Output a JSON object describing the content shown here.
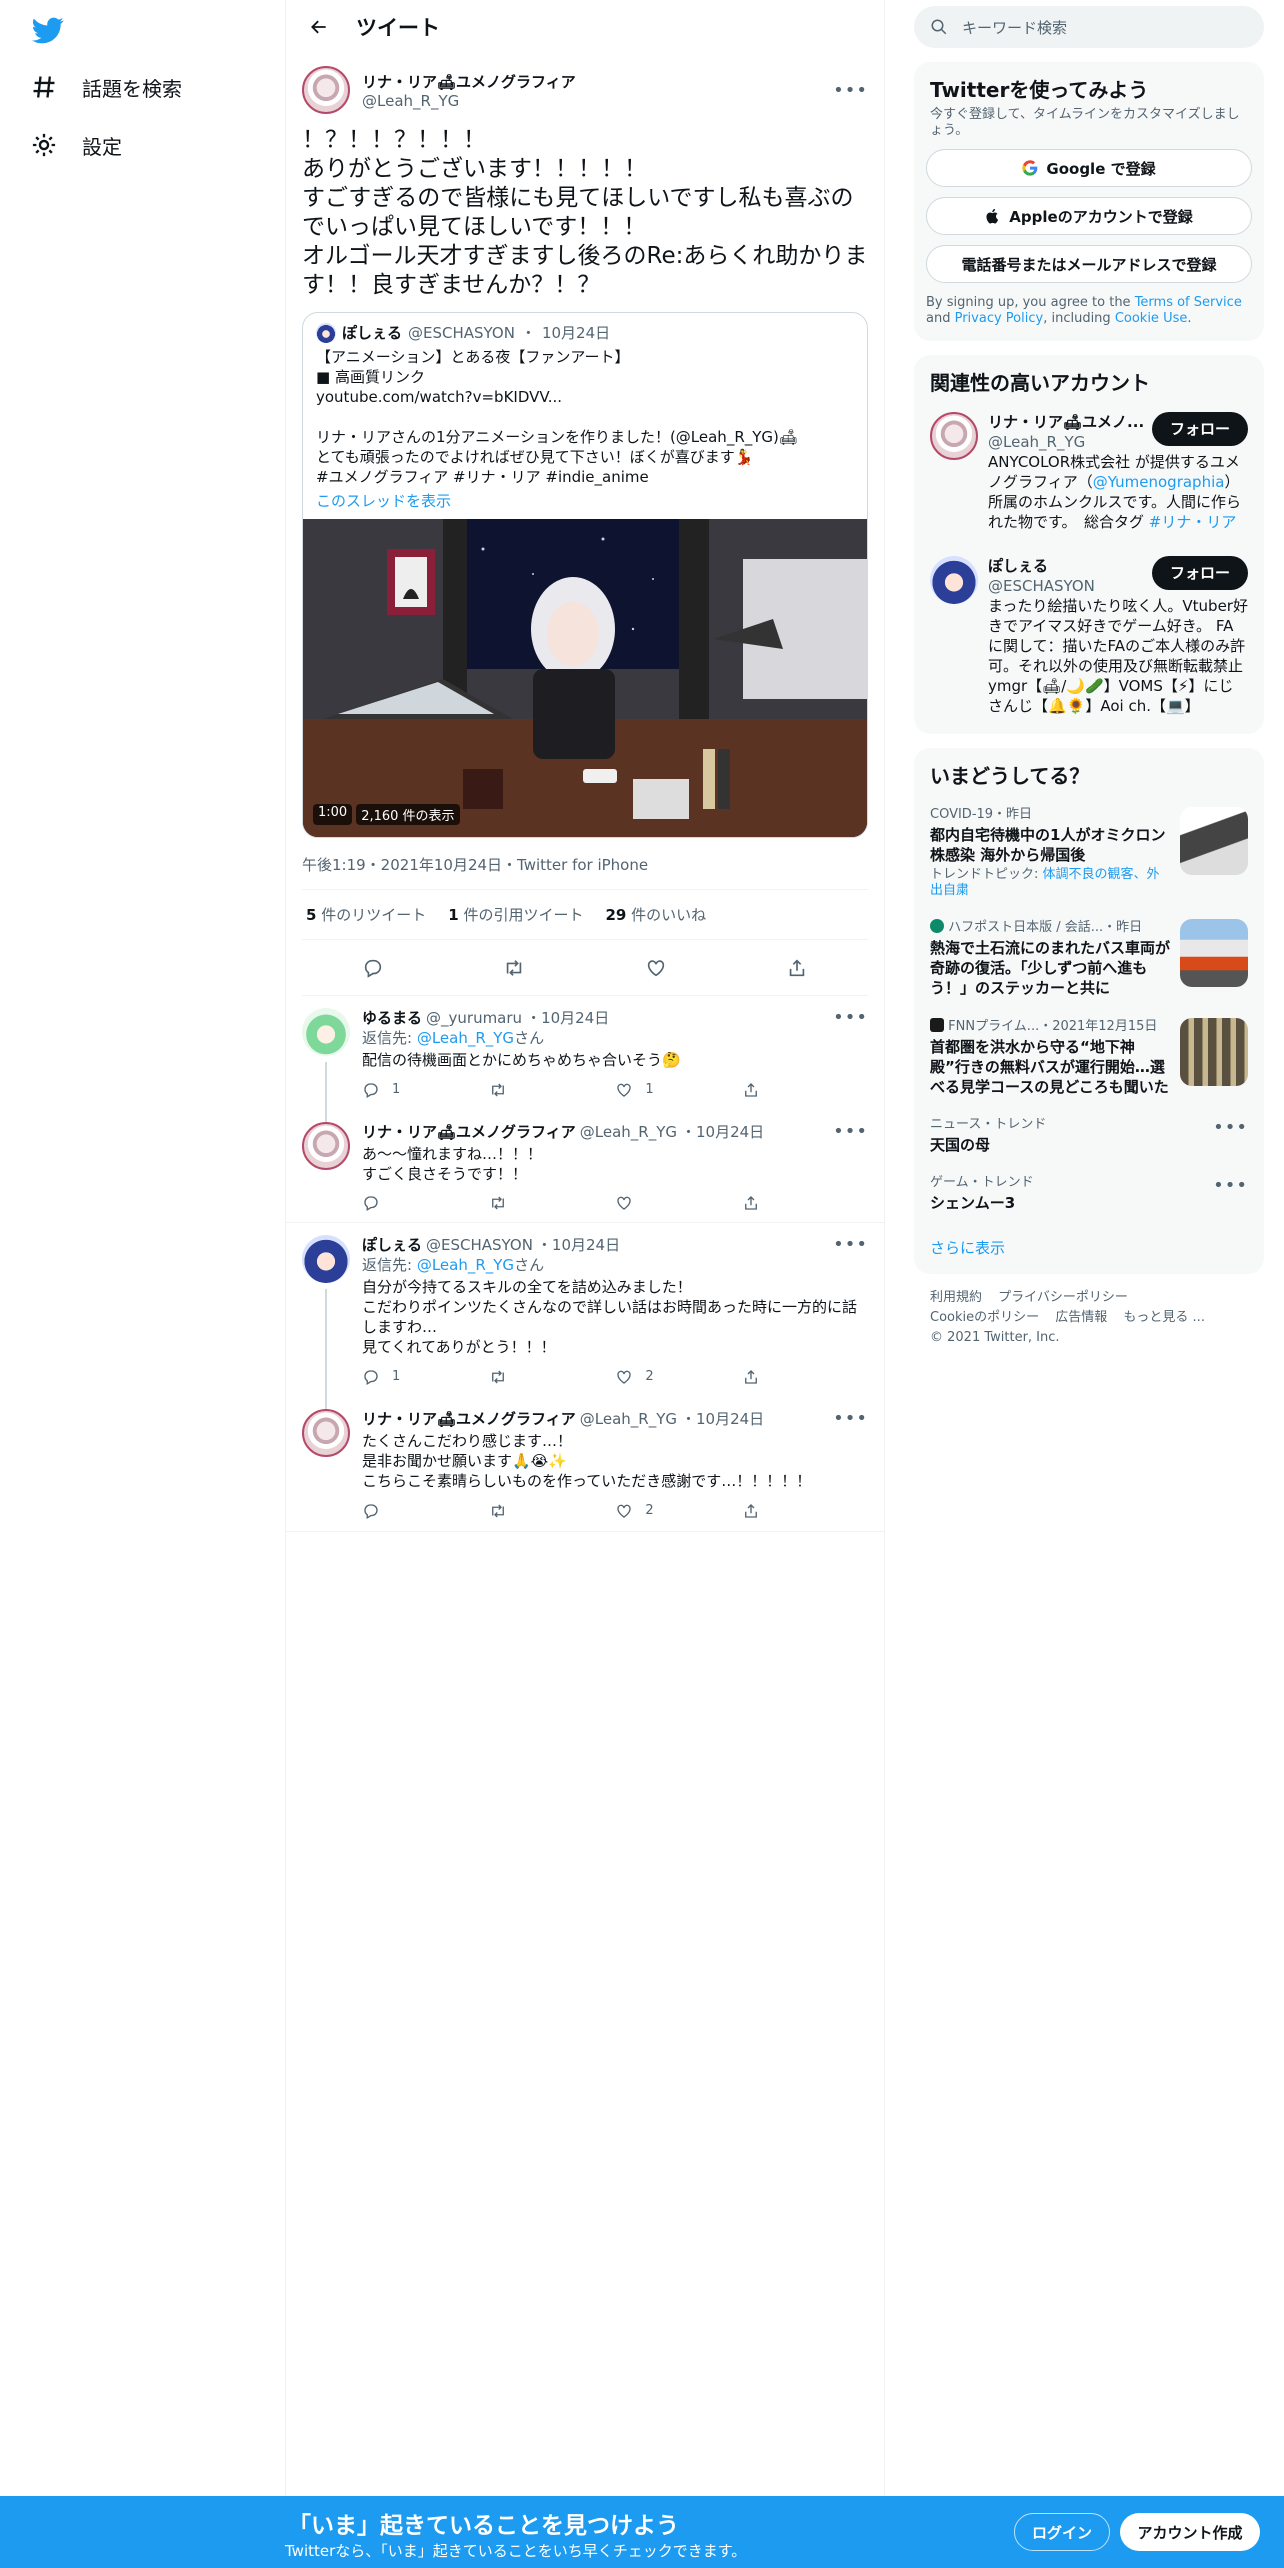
{
  "nav": {
    "items": [
      {
        "label": "話題を検索",
        "icon": "hashtag-icon"
      },
      {
        "label": "設定",
        "icon": "gear-icon"
      }
    ]
  },
  "header": {
    "title": "ツイート"
  },
  "main_tweet": {
    "name": "リナ・リア🛋ユメノグラフィア",
    "handle": "@Leah_R_YG",
    "text": "！？！！？！！！\nありがとうございます！！！！！\nすごすぎるので皆様にも見てほしいですし私も喜ぶのでいっぱい見てほしいです！！！\nオルゴール天才すぎますし後ろのRe:あらくれ助かります！！良すぎませんか？！？",
    "quote": {
      "name": "ぽしぇる",
      "handle": "@ESCHASYON",
      "date": "10月24日",
      "text": "【アニメーション】とある夜【ファンアート】\n■ 高画質リンク\nyoutube.com/watch?v=bKIDVV...\n\nリナ・リアさんの1分アニメーションを作りました！(@Leah_R_YG)🛋\nとても頑張ったのでよければぜひ見て下さい！ぼくが喜びます💃\n#ユメノグラフィア #リナ・リア #indie_anime",
      "thread_link": "このスレッドを表示",
      "video_duration": "1:00",
      "video_views": "2,160 件の表示"
    },
    "timestamp": "午後1:19・2021年10月24日・Twitter for iPhone",
    "stats": {
      "retweets_count": "5",
      "retweets_label": "件のリツイート",
      "quotes_count": "1",
      "quotes_label": "件の引用ツイート",
      "likes_count": "29",
      "likes_label": "件のいいね"
    }
  },
  "replies": [
    {
      "name": "ゆるまる",
      "handle": "@_yurumaru",
      "date": "・10月24日",
      "reply_to_label": "返信先: ",
      "reply_to_handle": "@Leah_R_YG",
      "reply_to_suffix": "さん",
      "text": "配信の待機画面とかにめちゃめちゃ合いそう🤔",
      "reply_count": "1",
      "retweet_count": "",
      "like_count": "1"
    },
    {
      "name": "リナ・リア🛋ユメノグラフィア",
      "handle": "@Leah_R_YG",
      "date": "・10月24日",
      "text": "あ〜〜憧れますね…！！！\nすごく良さそうです！！",
      "reply_count": "",
      "retweet_count": "",
      "like_count": ""
    },
    {
      "name": "ぽしぇる",
      "handle": "@ESCHASYON",
      "date": "・10月24日",
      "reply_to_label": "返信先: ",
      "reply_to_handle": "@Leah_R_YG",
      "reply_to_suffix": "さん",
      "text": "自分が今持てるスキルの全てを詰め込みました！\nこだわりポインツたくさんなので詳しい話はお時間あった時に一方的に話しますわ…\n見てくれてありがとう！！！",
      "reply_count": "1",
      "retweet_count": "",
      "like_count": "2"
    },
    {
      "name": "リナ・リア🛋ユメノグラフィア",
      "handle": "@Leah_R_YG",
      "date": "・10月24日",
      "text": "たくさんこだわり感じます…！\n是非お聞かせ願います🙏😭✨\nこちらこそ素晴らしいものを作っていただき感謝です…！！！！！",
      "reply_count": "",
      "retweet_count": "",
      "like_count": "2"
    }
  ],
  "search": {
    "placeholder": "キーワード検索"
  },
  "signup_card": {
    "title": "Twitterを使ってみよう",
    "subtitle": "今すぐ登録して、タイムラインをカスタマイズしましょう。",
    "google_btn": "Google で登録",
    "apple_btn": "Appleのアカウントで登録",
    "phone_btn": "電話番号またはメールアドレスで登録",
    "terms_prefix": "By signing up, you agree to the ",
    "terms_link": "Terms of Service",
    "terms_and": " and ",
    "privacy_link": "Privacy Policy",
    "terms_including": ", including ",
    "cookie_link": "Cookie Use",
    "terms_end": "."
  },
  "related": {
    "title": "関連性の高いアカウント",
    "accounts": [
      {
        "name": "リナ・リア🛋ユメノ...",
        "handle": "@Leah_R_YG",
        "follow": "フォロー",
        "bio_pre": "ANYCOLOR株式会社 が提供するユメノグラフィア（",
        "bio_link1": "@Yumenographia",
        "bio_mid": "）所属のホムンクルスです。人間に作られた物です。　総合タグ ",
        "bio_link2": "#リナ・リア"
      },
      {
        "name": "ぽしぇる",
        "handle": "@ESCHASYON",
        "follow": "フォロー",
        "bio": "まったり絵描いたり呟く人。Vtuber好きでアイマス好きでゲーム好き。 FAに関して：描いたFAのご本人様のみ許可。それ以外の使用及び無断転載禁止 ymgr【🛋/🌙🥒】VOMS【⚡】にじさんじ【🔔🌻】Aoi ch.【💻】"
      }
    ]
  },
  "trends": {
    "title": "いまどうしてる？",
    "items": [
      {
        "meta": "COVID-19・昨日",
        "title": "都内自宅待機中の1人がオミクロン株感染 海外から帰国後",
        "sub_label": "トレンドトピック: ",
        "sub_link": "体調不良の観客、外出自粛"
      },
      {
        "meta": "ハフポスト日本版 / 会話...・昨日",
        "title": "熱海で土石流にのまれたバス車両が奇跡の復活。「少しずつ前へ進もう！」のステッカーと共に"
      },
      {
        "meta": "FNNプライム...・2021年12月15日",
        "title": "首都圏を洪水から守る“地下神殿”行きの無料バスが運行開始…選べる見学コースの見どころも聞いた"
      },
      {
        "meta": "ニュース・トレンド",
        "title": "天国の母"
      },
      {
        "meta": "ゲーム・トレンド",
        "title": "シェンムー3"
      }
    ],
    "show_more": "さらに表示"
  },
  "footer": {
    "links": [
      "利用規約",
      "プライバシーポリシー",
      "Cookieのポリシー",
      "広告情報",
      "もっと見る ..."
    ],
    "copyright": "© 2021 Twitter, Inc."
  },
  "bottom_bar": {
    "title": "「いま」起きていることを見つけよう",
    "subtitle": "Twitterなら、「いま」起きていることをいち早くチェックできます。",
    "login": "ログイン",
    "signup": "アカウント作成"
  },
  "colors": {
    "accent": "#1d9bf0",
    "text": "#0f1419",
    "muted": "#536471",
    "border": "#eff3f4"
  }
}
